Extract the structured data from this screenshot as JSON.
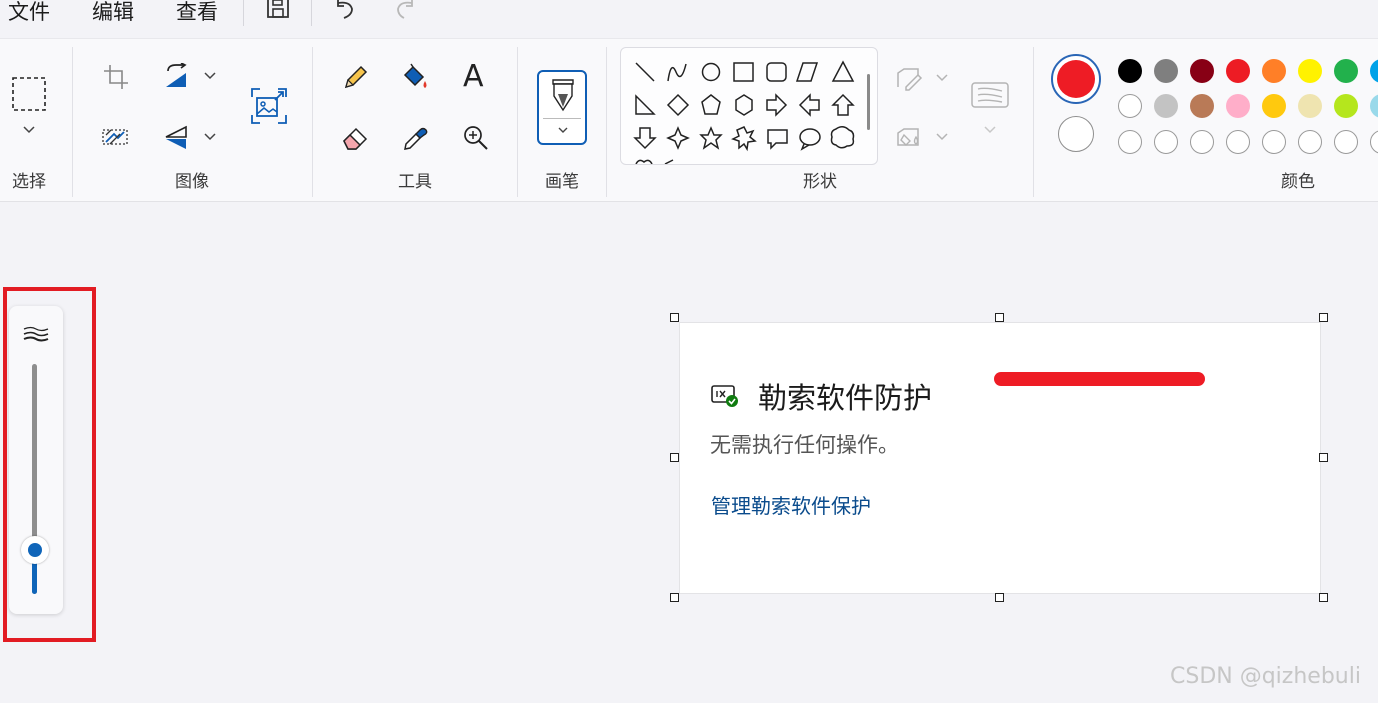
{
  "menu": {
    "file": "文件",
    "edit": "编辑",
    "view": "查看"
  },
  "ribbon": {
    "groups": {
      "select": "选择",
      "image": "图像",
      "tools": "工具",
      "brushes": "画笔",
      "shapes": "形状",
      "colors": "颜色"
    }
  },
  "colors": {
    "primary": "#ee1c25",
    "secondary": "#ffffff",
    "palette_row1": [
      "#000000",
      "#7f7f7f",
      "#880015",
      "#ed1c24",
      "#ff7f27",
      "#fff200",
      "#22b14c",
      "#00a2e8"
    ],
    "palette_row2": [
      "#ffffff",
      "#c3c3c3",
      "#b97a57",
      "#ffaec9",
      "#ffc90e",
      "#efe4b0",
      "#b5e61d",
      "#99d9ea"
    ]
  },
  "size_slider": {
    "value_fraction": 0.16,
    "accent": "#0f65b9"
  },
  "card": {
    "title": "勒索软件防护",
    "description": "无需执行任何操作。",
    "link": "管理勒索软件保护"
  },
  "watermark": "CSDN @qizhebuli"
}
